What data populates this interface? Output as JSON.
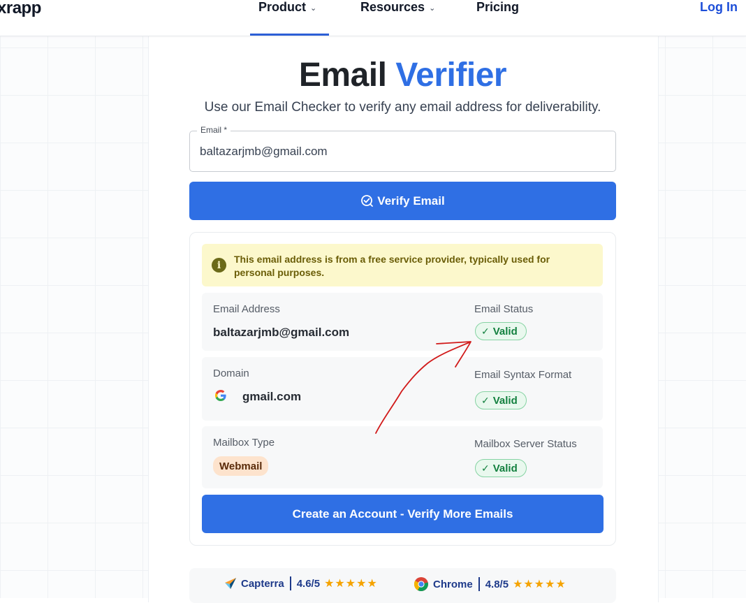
{
  "header": {
    "logo": "xrapp",
    "nav": {
      "product": "Product",
      "resources": "Resources",
      "pricing": "Pricing"
    },
    "login": "Log In"
  },
  "hero": {
    "title_part1": "Email",
    "title_part2": "Verifier",
    "subtitle": "Use our Email Checker to verify any email address for deliverability."
  },
  "form": {
    "email_label": "Email *",
    "email_value": "baltazarjmb@gmail.com",
    "verify_button": "Verify Email"
  },
  "results": {
    "notice": "This email address is from a free service provider, typically used for personal purposes.",
    "email_address_label": "Email Address",
    "email_address_value": "baltazarjmb@gmail.com",
    "email_status_label": "Email Status",
    "email_status_value": "Valid",
    "domain_label": "Domain",
    "domain_value": "gmail.com",
    "syntax_label": "Email Syntax Format",
    "syntax_value": "Valid",
    "mailbox_type_label": "Mailbox Type",
    "mailbox_type_value": "Webmail",
    "mailbox_server_label": "Mailbox Server Status",
    "mailbox_server_value": "Valid",
    "cta_button": "Create an Account - Verify More Emails"
  },
  "ratings": {
    "capterra_name": "Capterra",
    "capterra_score": "4.6/5",
    "chrome_name": "Chrome",
    "chrome_score": "4.8/5",
    "stars": "★★★★★"
  },
  "colors": {
    "accent": "#2f6fe4",
    "valid": "#13803f",
    "notice_bg": "#fcf8cc",
    "annotation": "#d11a1a"
  },
  "icons": [
    "chevron-down-icon",
    "verify-check-icon",
    "info-icon",
    "check-icon",
    "google-icon",
    "capterra-icon",
    "chrome-icon",
    "star-icon"
  ]
}
